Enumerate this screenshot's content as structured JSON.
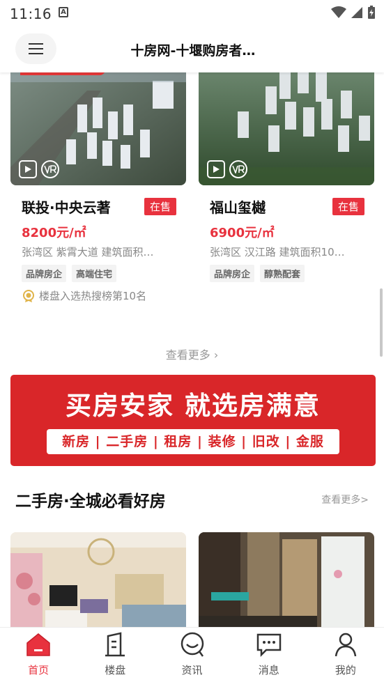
{
  "status_bar": {
    "time": "11:16",
    "notification_icon": "A"
  },
  "header": {
    "title": "十房网-十堰购房者…"
  },
  "new_houses": [
    {
      "name": "联投·中央云著",
      "sale_status": "在售",
      "price": "8200元/㎡",
      "address": "张湾区  紫霄大道  建筑面积…",
      "tags": [
        "品牌房企",
        "高端住宅"
      ],
      "rank_note": "楼盘入选热搜榜第10名"
    },
    {
      "name": "福山玺樾",
      "sale_status": "在售",
      "price": "6900元/㎡",
      "address": "张湾区  汉江路  建筑面积10…",
      "tags": [
        "品牌房企",
        "醇熟配套"
      ]
    }
  ],
  "see_more_new": "查看更多",
  "banner": {
    "slogan": "买房安家 就选房满意",
    "services": "新房 | 二手房 | 租房 | 装修 | 旧改 | 金服"
  },
  "second_hand": {
    "title": "二手房·全城必看好房",
    "see_more": "查看更多>"
  },
  "bottom_nav": [
    {
      "label": "首页",
      "icon": "home-icon",
      "active": true
    },
    {
      "label": "楼盘",
      "icon": "building-icon",
      "active": false
    },
    {
      "label": "资讯",
      "icon": "news-bubble-icon",
      "active": false
    },
    {
      "label": "消息",
      "icon": "message-icon",
      "active": false
    },
    {
      "label": "我的",
      "icon": "profile-icon",
      "active": false
    }
  ],
  "colors": {
    "accent": "#e8323e",
    "banner": "#d92629",
    "muted": "#999999"
  }
}
